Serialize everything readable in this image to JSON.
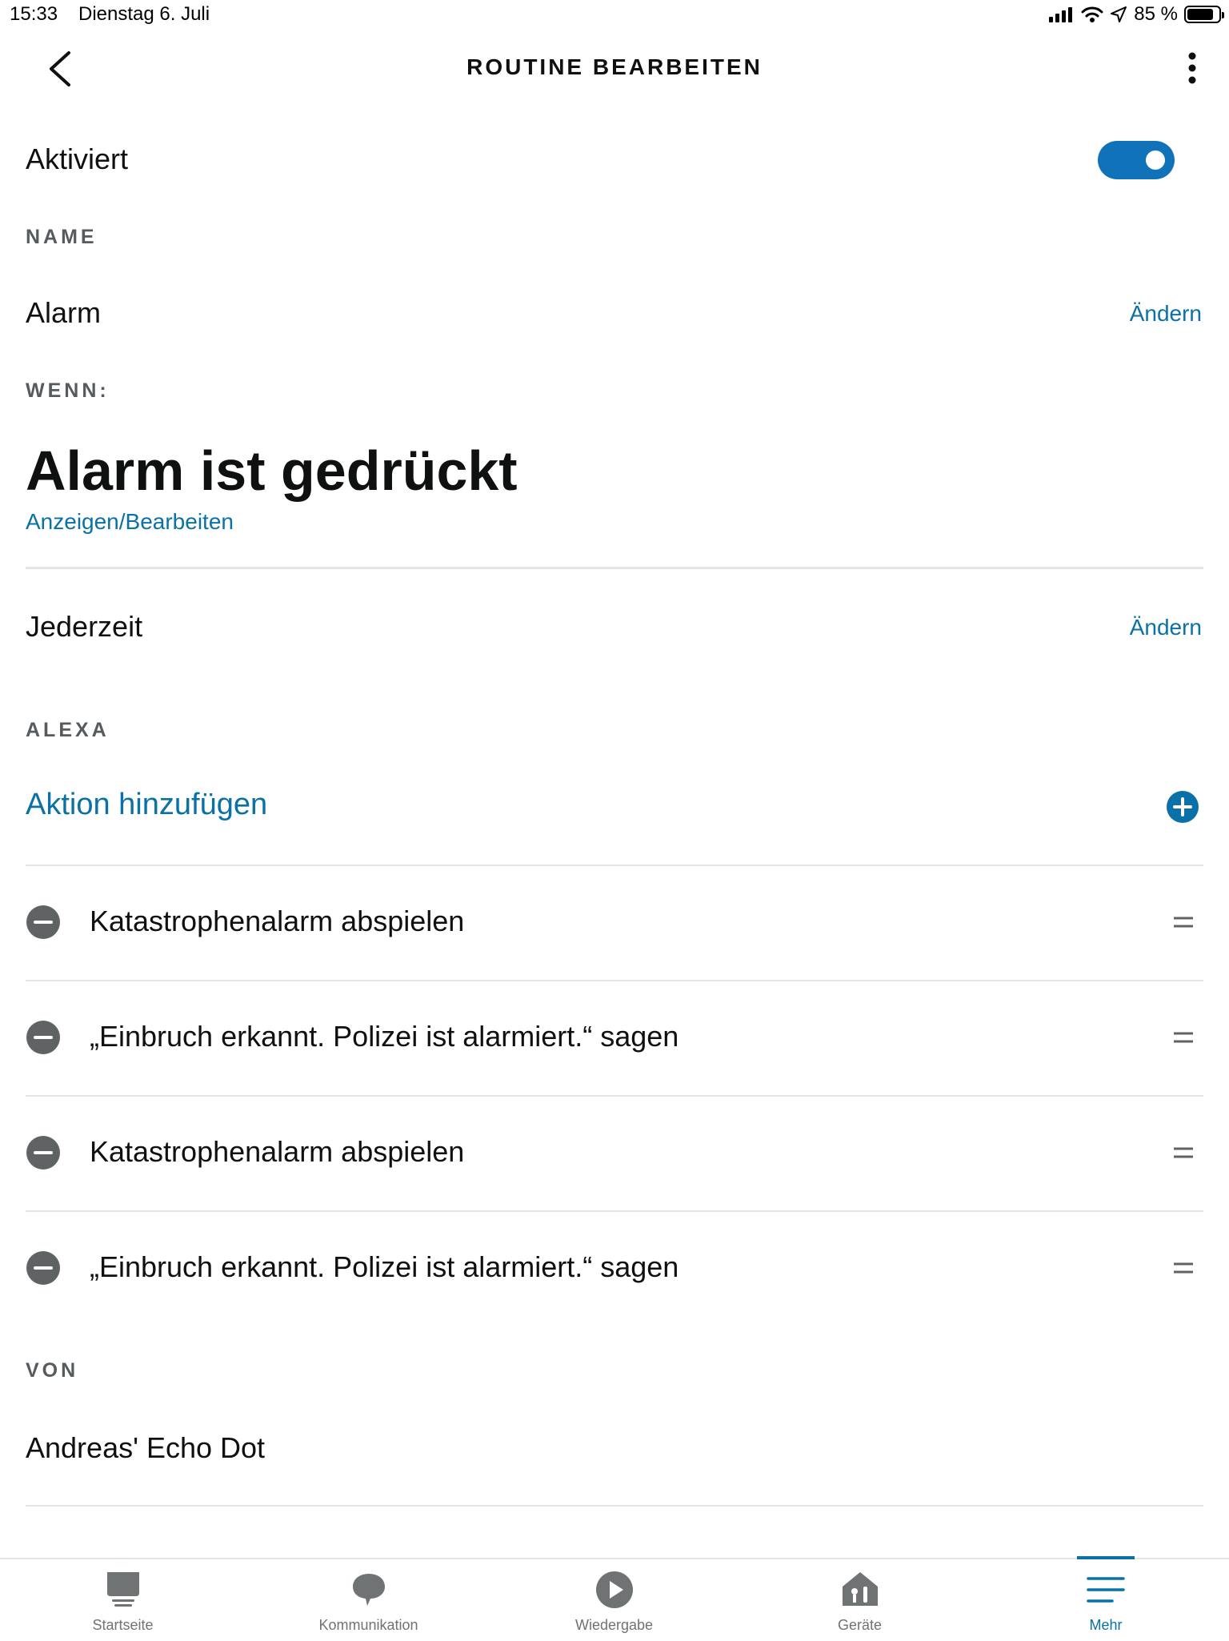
{
  "status_bar": {
    "time": "15:33",
    "date": "Dienstag 6. Juli",
    "battery_text": "85 %",
    "battery_level": 0.85,
    "icons": [
      "signal-icon",
      "wifi-icon",
      "location-icon",
      "battery-icon"
    ]
  },
  "header": {
    "title": "ROUTINE BEARBEITEN",
    "back_icon": "chevron-left-icon",
    "more_icon": "more-vertical-icon"
  },
  "activated": {
    "label": "Aktiviert",
    "enabled": true
  },
  "name_section": {
    "heading": "NAME",
    "value": "Alarm",
    "change_label": "Ändern"
  },
  "when_section": {
    "heading": "WENN:",
    "trigger": "Alarm ist gedrückt",
    "view_edit_label": "Anzeigen/Bearbeiten",
    "schedule": "Jederzeit",
    "change_label": "Ändern"
  },
  "alexa_section": {
    "heading": "ALEXA",
    "add_action_label": "Aktion hinzufügen",
    "actions": [
      "Katastrophenalarm abspielen",
      "„Einbruch erkannt. Polizei ist alarmiert.“ sagen",
      "Katastrophenalarm abspielen",
      "„Einbruch erkannt. Polizei ist alarmiert.“ sagen"
    ]
  },
  "from_section": {
    "heading": "VON",
    "device": "Andreas' Echo Dot"
  },
  "tabbar": {
    "tabs": [
      {
        "label": "Startseite",
        "icon": "home-echo-icon",
        "active": false
      },
      {
        "label": "Kommunikation",
        "icon": "speech-bubble-icon",
        "active": false
      },
      {
        "label": "Wiedergabe",
        "icon": "play-icon",
        "active": false
      },
      {
        "label": "Geräte",
        "icon": "devices-house-icon",
        "active": false
      },
      {
        "label": "Mehr",
        "icon": "menu-lines-icon",
        "active": true
      }
    ]
  },
  "colors": {
    "accent": "#0a71a7",
    "toggle": "#1073b9",
    "text": "#0f1111",
    "section_label": "#555b5e",
    "divider": "#e3e6e6",
    "icon_gray": "#6f7373"
  }
}
